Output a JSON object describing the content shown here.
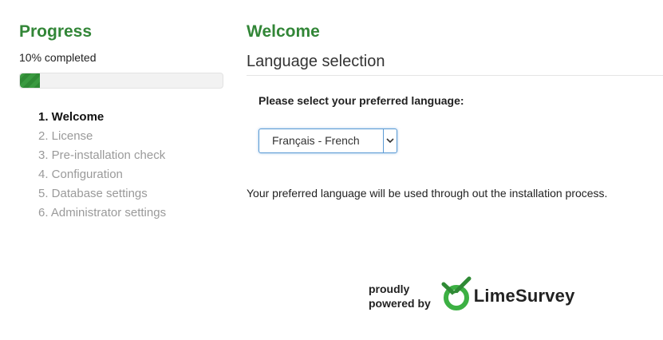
{
  "sidebar": {
    "title": "Progress",
    "progress_text": "10% completed",
    "progress_value": 0.1,
    "steps": [
      {
        "label": "1. Welcome",
        "active": true
      },
      {
        "label": "2. License",
        "active": false
      },
      {
        "label": "3. Pre-installation check",
        "active": false
      },
      {
        "label": "4. Configuration",
        "active": false
      },
      {
        "label": "5. Database settings",
        "active": false
      },
      {
        "label": "6. Administrator settings",
        "active": false
      }
    ]
  },
  "main": {
    "title": "Welcome",
    "section_title": "Language selection",
    "language_prompt": "Please select your preferred language:",
    "language_select": {
      "selected": "Français - French"
    },
    "note": "Your preferred language will be used through out the installation process."
  },
  "footer": {
    "powered_line1": "proudly",
    "powered_line2": "powered by",
    "brand": "LimeSurvey",
    "logo_icon": "limesurvey-logo-icon"
  },
  "colors": {
    "accent": "#328637",
    "progress": "#2f8a35",
    "select_border": "#5b9bd5",
    "muted_step": "#9a9a9a"
  }
}
